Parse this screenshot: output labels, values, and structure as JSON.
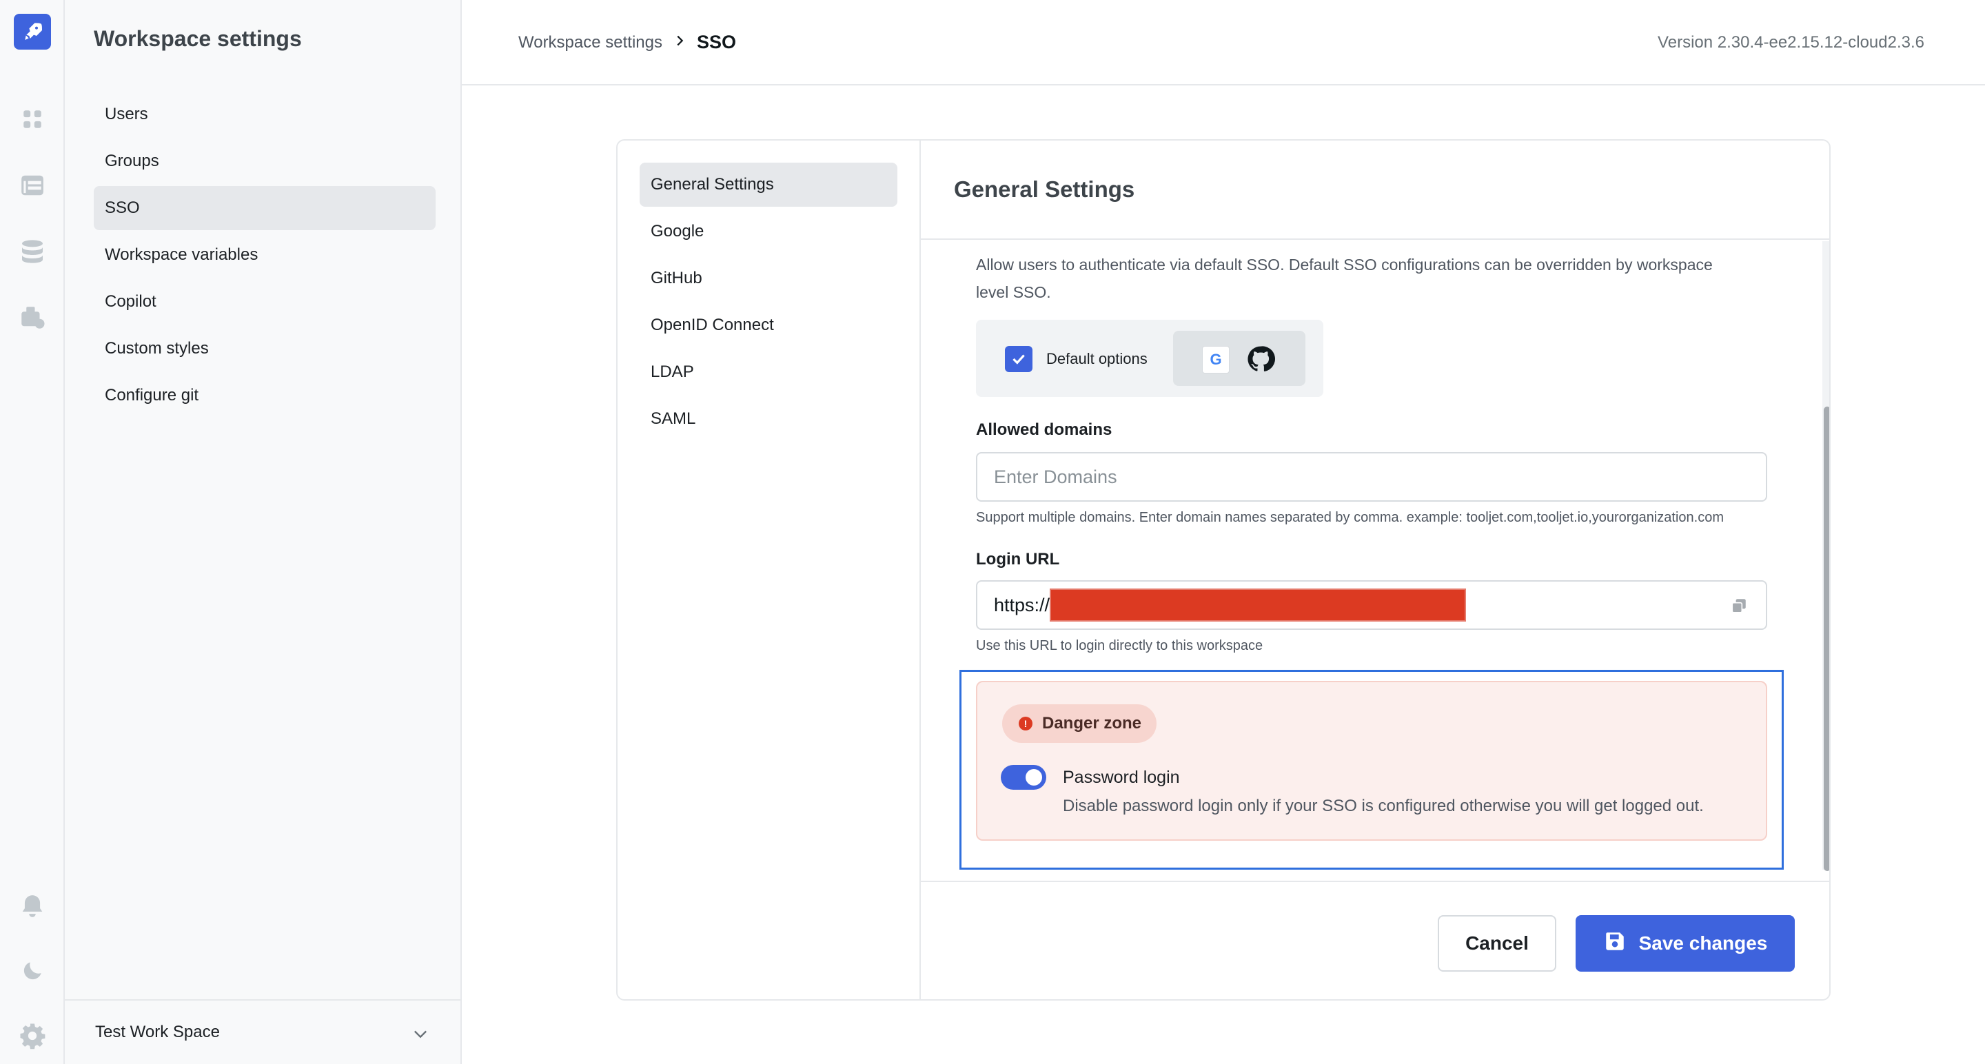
{
  "rail": {
    "icons": [
      "rocket-logo-icon",
      "apps-grid-icon",
      "table-icon",
      "database-icon",
      "marketplace-icon",
      "bell-icon",
      "moon-icon",
      "gear-icon"
    ]
  },
  "sidebar": {
    "title": "Workspace settings",
    "items": [
      {
        "label": "Users"
      },
      {
        "label": "Groups"
      },
      {
        "label": "SSO"
      },
      {
        "label": "Workspace variables"
      },
      {
        "label": "Copilot"
      },
      {
        "label": "Custom styles"
      },
      {
        "label": "Configure git"
      }
    ],
    "active_index": 2,
    "workspace_name": "Test Work Space"
  },
  "header": {
    "breadcrumb_parent": "Workspace settings",
    "breadcrumb_current": "SSO",
    "version": "Version 2.30.4-ee2.15.12-cloud2.3.6"
  },
  "sso_nav": {
    "items": [
      {
        "label": "General Settings"
      },
      {
        "label": "Google"
      },
      {
        "label": "GitHub"
      },
      {
        "label": "OpenID Connect"
      },
      {
        "label": "LDAP"
      },
      {
        "label": "SAML"
      }
    ],
    "active_index": 0
  },
  "general": {
    "title": "General Settings",
    "description": "Allow users to authenticate via default SSO. Default SSO configurations can be overridden by workspace level SSO.",
    "default_options_label": "Default options",
    "default_options_checked": true,
    "provider_g_letter": "G",
    "allowed_domains_label": "Allowed domains",
    "allowed_domains_placeholder": "Enter Domains",
    "allowed_domains_help": "Support multiple domains. Enter domain names separated by comma. example: tooljet.com,tooljet.io,yourorganization.com",
    "login_url_label": "Login URL",
    "login_url_prefix": "https://",
    "login_url_help": "Use this URL to login directly to this workspace",
    "danger_badge": "Danger zone",
    "danger_badge_icon": "!",
    "password_login_label": "Password login",
    "password_login_enabled": true,
    "password_login_desc": "Disable password login only if your SSO is configured otherwise you will get logged out."
  },
  "actions": {
    "cancel": "Cancel",
    "save": "Save changes"
  },
  "colors": {
    "accent": "#3e63dd",
    "danger": "#dc3a22",
    "danger_bg": "#fcefed"
  }
}
